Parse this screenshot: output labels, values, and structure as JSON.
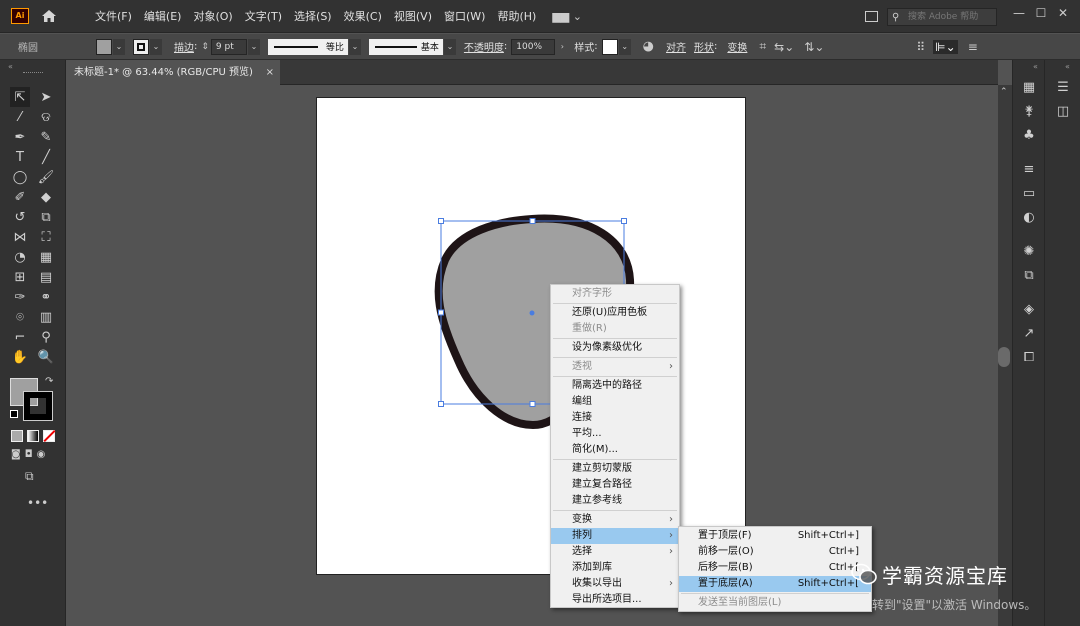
{
  "app": {
    "logo": "Ai",
    "search_placeholder": "搜索 Adobe 帮助",
    "menus": [
      "文件(F)",
      "编辑(E)",
      "对象(O)",
      "文字(T)",
      "选择(S)",
      "效果(C)",
      "视图(V)",
      "窗口(W)",
      "帮助(H)"
    ],
    "window_controls": [
      "—",
      "☐",
      "✕"
    ]
  },
  "control_bar": {
    "object_type": "椭圆",
    "stroke_label": "描边",
    "stroke_weight": "9 pt",
    "stroke_profile": "等比",
    "brush": "基本",
    "opacity_label": "不透明度",
    "opacity": "100%",
    "style_label": "样式",
    "align": "对齐",
    "shape": "形状",
    "transform": "变换"
  },
  "document_tab": {
    "title": "未标题-1* @ 63.44% (RGB/CPU 预览)",
    "close": "×"
  },
  "colors": {
    "fill": "#a0a0a0",
    "stroke": "#1e1416",
    "selection": "#4a7de0",
    "menu_highlight": "#99c9ef"
  },
  "context_menu": {
    "items": [
      {
        "label": "对齐字形",
        "disabled": true
      },
      {
        "label": "还原(U)应用色板"
      },
      {
        "label": "重做(R)",
        "disabled": true
      },
      {
        "label": "设为像素级优化"
      },
      {
        "label": "透视",
        "disabled": true,
        "submenu": true
      },
      {
        "label": "隔离选中的路径"
      },
      {
        "label": "编组"
      },
      {
        "label": "连接"
      },
      {
        "label": "平均..."
      },
      {
        "label": "简化(M)..."
      },
      {
        "label": "建立剪切蒙版"
      },
      {
        "label": "建立复合路径"
      },
      {
        "label": "建立参考线"
      },
      {
        "label": "变换",
        "submenu": true
      },
      {
        "label": "排列",
        "submenu": true,
        "highlighted": true
      },
      {
        "label": "选择",
        "submenu": true
      },
      {
        "label": "添加到库"
      },
      {
        "label": "收集以导出",
        "submenu": true
      },
      {
        "label": "导出所选项目..."
      }
    ]
  },
  "arrange_submenu": {
    "items": [
      {
        "label": "置于顶层(F)",
        "shortcut": "Shift+Ctrl+]"
      },
      {
        "label": "前移一层(O)",
        "shortcut": "Ctrl+]"
      },
      {
        "label": "后移一层(B)",
        "shortcut": "Ctrl+["
      },
      {
        "label": "置于底层(A)",
        "shortcut": "Shift+Ctrl+[",
        "highlighted": true
      },
      {
        "label": "发送至当前图层(L)",
        "disabled": true
      }
    ]
  },
  "overlay": {
    "watermark": "学霸资源宝库",
    "activate_windows": "转到\"设置\"以激活 Windows。"
  }
}
